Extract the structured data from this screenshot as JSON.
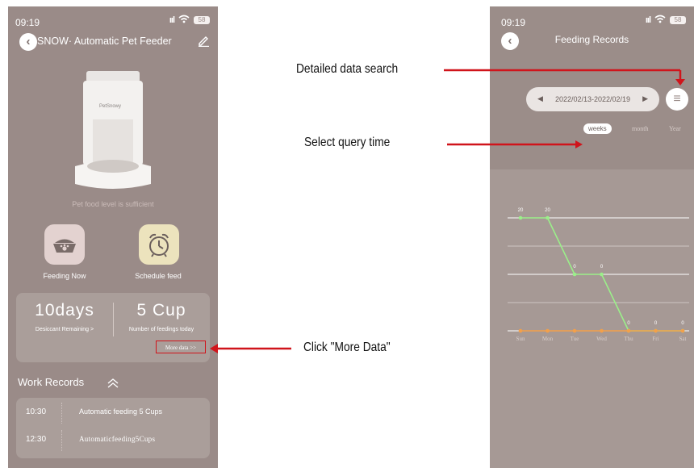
{
  "left_phone": {
    "status_time": "09:19",
    "battery": "58",
    "title": "SNOW· Automatic Pet Feeder",
    "feeder_brand": "PetSnowy",
    "food_status": "Pet food level is sufficient",
    "actions": [
      {
        "label": "Feeding Now",
        "icon": "food-bowl-icon"
      },
      {
        "label": "Schedule feed",
        "icon": "alarm-clock-icon"
      }
    ],
    "stats": {
      "days_value": "10days",
      "days_label": "Desiccant Remaining >",
      "cups_value": "5 Cup",
      "cups_label": "Number of feedings today",
      "more_data": "More data >>"
    },
    "work_records": {
      "title": "Work Records",
      "rows": [
        {
          "time": "10:30",
          "text": "Automatic feeding 5 Cups"
        },
        {
          "time": "12:30",
          "text": "Automaticfeeding5Cups"
        }
      ]
    },
    "accent_color": "#d0141b"
  },
  "right_phone": {
    "status_time": "09:19",
    "battery": "58",
    "title": "Feeding Records",
    "date_range": "2022/02/13-2022/02/19",
    "periods": [
      "weeks",
      "month",
      "Year"
    ],
    "selected_period": "weeks"
  },
  "chart_data": {
    "type": "line",
    "categories": [
      "Sun",
      "Mon",
      "Tue",
      "Wed",
      "Thu",
      "Fri",
      "Sat"
    ],
    "series": [
      {
        "values": [
          20,
          20,
          10,
          10,
          0,
          0,
          0
        ],
        "color": "#9bf08a"
      },
      {
        "values": [
          0,
          0,
          0,
          0,
          0,
          0,
          0
        ],
        "color": "#f3a04a"
      }
    ],
    "point_labels": [
      "20",
      "20",
      "0",
      "0",
      "0",
      "0",
      "0"
    ],
    "ylim": [
      0,
      22
    ],
    "grid": true
  },
  "annotations": {
    "detail_search": "Detailed data search",
    "select_time": "Select query time",
    "more_data": "Click \"More Data\""
  }
}
